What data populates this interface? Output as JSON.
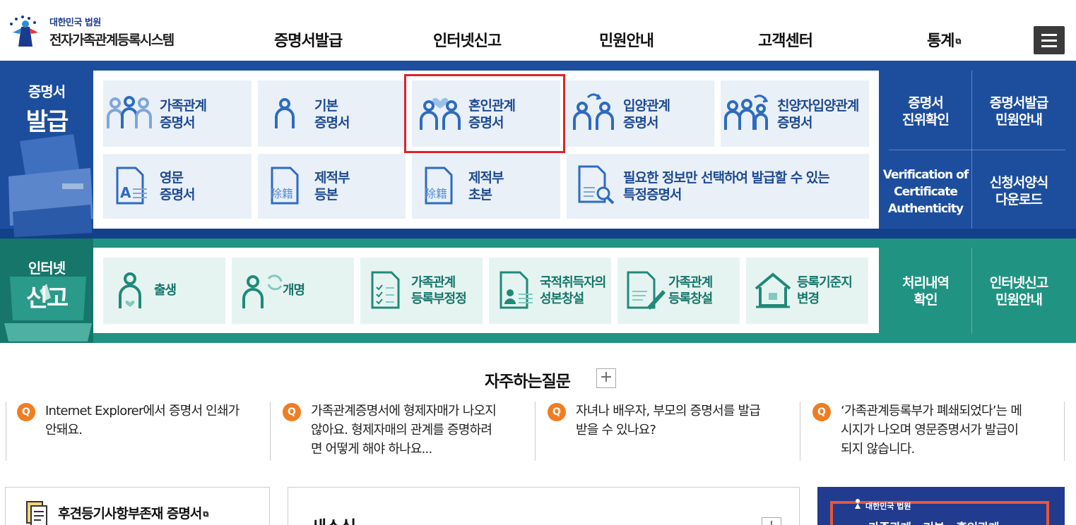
{
  "logo": {
    "small": "대한민국 법원",
    "main": "전자가족관계등록시스템"
  },
  "gnb": [
    {
      "label": "증명서발급"
    },
    {
      "label": "인터넷신고"
    },
    {
      "label": "민원안내"
    },
    {
      "label": "고객센터"
    },
    {
      "label": "통계"
    }
  ],
  "cert": {
    "side_l1": "증명서",
    "side_l2": "발급",
    "tiles": [
      {
        "label_1": "가족관계",
        "label_2": "증명서",
        "icon": "family-icon"
      },
      {
        "label_1": "기본",
        "label_2": "증명서",
        "icon": "person-icon"
      },
      {
        "label_1": "혼인관계",
        "label_2": "증명서",
        "icon": "couple-heart-icon"
      },
      {
        "label_1": "입양관계",
        "label_2": "증명서",
        "icon": "adoption-icon"
      },
      {
        "label_1": "친양자입양관계",
        "label_2": "증명서",
        "icon": "full-adoption-icon"
      },
      {
        "label_1": "영문",
        "label_2": "증명서",
        "icon": "english-document-icon"
      },
      {
        "label_1": "제적부",
        "label_2": "등본",
        "icon": "removed-register-icon",
        "badge": "除籍"
      },
      {
        "label_1": "제적부",
        "label_2": "초본",
        "icon": "removed-register-icon",
        "badge": "除籍"
      },
      {
        "label_1": "필요한 정보만 선택하여 발급할 수 있는",
        "label_2": "특정증명서",
        "icon": "search-document-icon"
      }
    ],
    "right_links": [
      {
        "l1": "증명서",
        "l2": "진위확인"
      },
      {
        "l1": "증명서발급",
        "l2": "민원안내"
      },
      {
        "l1": "Verification of",
        "l2": "Certificate",
        "l3": "Authenticity"
      },
      {
        "l1": "신청서양식",
        "l2": "다운로드"
      }
    ]
  },
  "net": {
    "side_l1": "인터넷",
    "side_l2": "신고",
    "tiles": [
      {
        "label_1": "출생",
        "label_2": "",
        "icon": "birth-icon"
      },
      {
        "label_1": "개명",
        "label_2": "",
        "icon": "rename-icon"
      },
      {
        "label_1": "가족관계",
        "label_2": "등록부정정",
        "icon": "checklist-icon"
      },
      {
        "label_1": "국적취득자의",
        "label_2": "성본창설",
        "icon": "id-card-icon"
      },
      {
        "label_1": "가족관계",
        "label_2": "등록창설",
        "icon": "write-document-icon"
      },
      {
        "label_1": "등록기준지",
        "label_2": "변경",
        "icon": "house-icon"
      }
    ],
    "right_links": [
      {
        "l1": "처리내역",
        "l2": "확인"
      },
      {
        "l1": "인터넷신고",
        "l2": "민원안내"
      }
    ]
  },
  "faq": {
    "title": "자주하는질문",
    "q_mark": "Q",
    "items": [
      {
        "l1": "Internet Explorer에서 증명서 인쇄가",
        "l2": "안돼요.",
        "l3": ""
      },
      {
        "l1": "가족관계증명서에 형제자매가 나오지",
        "l2": "않아요. 형제자매의 관계를 증명하려",
        "l3": "면 어떻게 해야 하나요..."
      },
      {
        "l1": "자녀나 배우자, 부모의 증명서를 발급",
        "l2": "받을 수 있나요?",
        "l3": ""
      },
      {
        "l1": "‘가족관계등록부가 폐쇄되었다’는 메",
        "l2": "시지가 나오며 영문증명서가 발급이",
        "l3": "되지 않습니다."
      }
    ]
  },
  "bottom": {
    "box1_title": "후견등기사항부존재 증명서",
    "box2_title": "새소식",
    "box3_small": "대한민국 법원",
    "box3_big": "가족관계 · 기본 · 혼인관계"
  },
  "colors": {
    "cert_blue": "#1d4e9e",
    "net_green": "#219382",
    "highlight_red": "#e0222a",
    "faq_orange": "#ef7d22"
  }
}
